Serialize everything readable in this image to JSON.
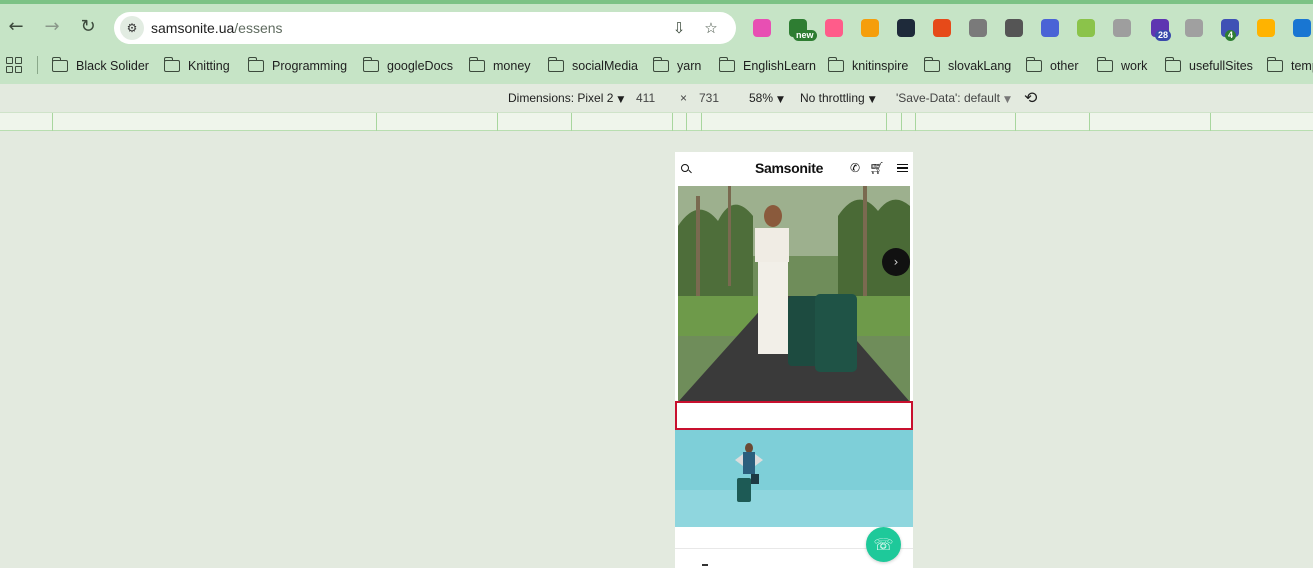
{
  "browser": {
    "url_host": "samsonite.ua",
    "url_path": "/essens",
    "extensions": [
      {
        "name": "gradient-extension-icon",
        "color": "#e84fb3"
      },
      {
        "name": "new-extension-icon",
        "color": "#2e7d32",
        "badge": "new"
      },
      {
        "name": "color-wheel-icon",
        "color": "#ff5c8a"
      },
      {
        "name": "orange-extension-icon",
        "color": "#f59e0b"
      },
      {
        "name": "react-devtools-icon",
        "color": "#1e2a3a"
      },
      {
        "name": "people-extension-icon",
        "color": "#e64a19"
      },
      {
        "name": "camera-icon",
        "color": "#7a7a7a"
      },
      {
        "name": "check-circle-icon",
        "color": "#555555"
      },
      {
        "name": "numbered-extension-icon",
        "color": "#4a63d6"
      },
      {
        "name": "palette-extension-icon",
        "color": "#8bc34a"
      },
      {
        "name": "compass-icon",
        "color": "#9e9e9e"
      },
      {
        "name": "graduation-cap-icon",
        "color": "#5e35b1",
        "badge": "28"
      },
      {
        "name": "grid-extension-icon",
        "color": "#a0a0a0"
      },
      {
        "name": "code-extension-icon",
        "color": "#3f51b5",
        "badge": "4"
      },
      {
        "name": "ring-extension-icon",
        "color": "#ffb300"
      },
      {
        "name": "tag-extension-icon",
        "color": "#1976d2"
      }
    ]
  },
  "bookmarks": [
    "Black Solider",
    "Knitting",
    "Programming",
    "googleDocs",
    "money",
    "socialMedia",
    "yarn",
    "EnglishLearn",
    "knitinspire",
    "slovakLang",
    "other",
    "work",
    "usefullSites",
    "temp"
  ],
  "devtools": {
    "dimensions_label": "Dimensions: Pixel 2",
    "width": "411",
    "times": "×",
    "height": "731",
    "zoom": "58%",
    "throttling": "No throttling",
    "save_data": "'Save-Data': default"
  },
  "site": {
    "logo": "Samsonite"
  },
  "colors": {
    "accent": "#c6e4c6",
    "highlight": "#c8102e",
    "chat": "#1ec99a"
  }
}
